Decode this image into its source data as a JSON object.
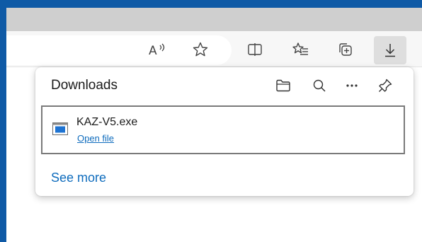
{
  "toolbar": {
    "icons": [
      "read-aloud-icon",
      "favorite-star-icon",
      "split-screen-icon",
      "favorites-icon",
      "collections-icon",
      "downloads-icon"
    ]
  },
  "downloads_panel": {
    "title": "Downloads",
    "header_icons": [
      "folder-icon",
      "search-icon",
      "more-options-icon",
      "pin-icon"
    ],
    "items": [
      {
        "file_name": "KAZ-V5.exe",
        "action_label": "Open file",
        "icon": "exe-file-icon"
      }
    ],
    "see_more_label": "See more"
  },
  "colors": {
    "window_border": "#0f5aa6",
    "titlebar": "#cfcfcf",
    "toolbar": "#f7f7f7",
    "link": "#0f6cbd"
  }
}
